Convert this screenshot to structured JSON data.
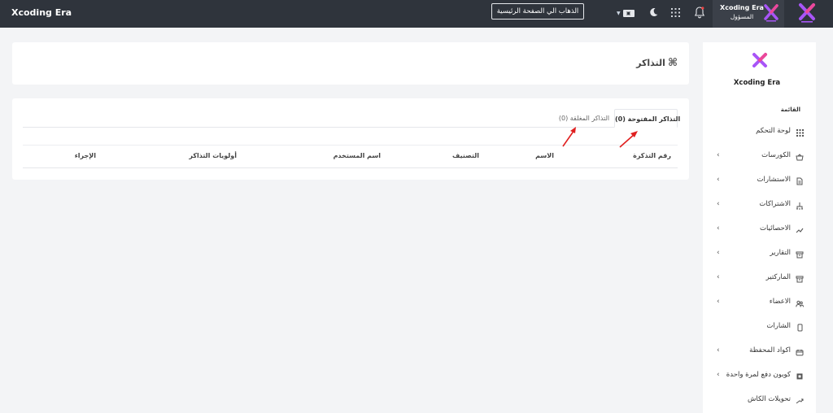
{
  "app": {
    "brand": "Xcoding Era"
  },
  "topbar": {
    "home_button": "الذهاب الي الصفحة الرئيسية",
    "language_icon": "language-flag-icon",
    "theme_icon": "moon-icon",
    "apps_icon": "grid-icon",
    "notifications_icon": "bell-icon",
    "user": {
      "name": "Xcoding Era",
      "role": "المسؤول"
    }
  },
  "page": {
    "title": "التذاكر"
  },
  "tickets": {
    "tabs": [
      {
        "label": "التذاكر المفتوحة (0)",
        "active": true
      },
      {
        "label": "التذاكر المغلقة (0)",
        "active": false
      }
    ],
    "columns": [
      "رقم التذكرة",
      "الاسم",
      "التصنيف",
      "اسم المستخدم",
      "أولويات التذاكر",
      "الإجراء"
    ],
    "rows": []
  },
  "sidebar": {
    "brand": "Xcoding Era",
    "heading": "القائمة",
    "items": [
      {
        "label": "لوحة التحكم",
        "icon": "dashboard-icon",
        "has_submenu": false
      },
      {
        "label": "الكورسات",
        "icon": "courses-icon",
        "has_submenu": true
      },
      {
        "label": "الاستشارات",
        "icon": "consultations-icon",
        "has_submenu": true
      },
      {
        "label": "الاشتراكات",
        "icon": "subscriptions-icon",
        "has_submenu": true
      },
      {
        "label": "الاحصائيات",
        "icon": "statistics-icon",
        "has_submenu": true
      },
      {
        "label": "التقارير",
        "icon": "reports-icon",
        "has_submenu": true
      },
      {
        "label": "الماركتير",
        "icon": "marketer-icon",
        "has_submenu": true
      },
      {
        "label": "الاعضاء",
        "icon": "members-icon",
        "has_submenu": true
      },
      {
        "label": "الشارات",
        "icon": "badges-icon",
        "has_submenu": false
      },
      {
        "label": "اكواد المحفظة",
        "icon": "wallet-codes-icon",
        "has_submenu": true
      },
      {
        "label": "كوبون دفع لمرة واحدة",
        "icon": "coupon-icon",
        "has_submenu": true
      },
      {
        "label": "تحويلات الكاش",
        "icon": "cash-transfer-icon",
        "has_submenu": false
      }
    ]
  },
  "colors": {
    "topbar": "#2f343c",
    "arrow": "#e02020",
    "background": "#f3f4f6"
  }
}
